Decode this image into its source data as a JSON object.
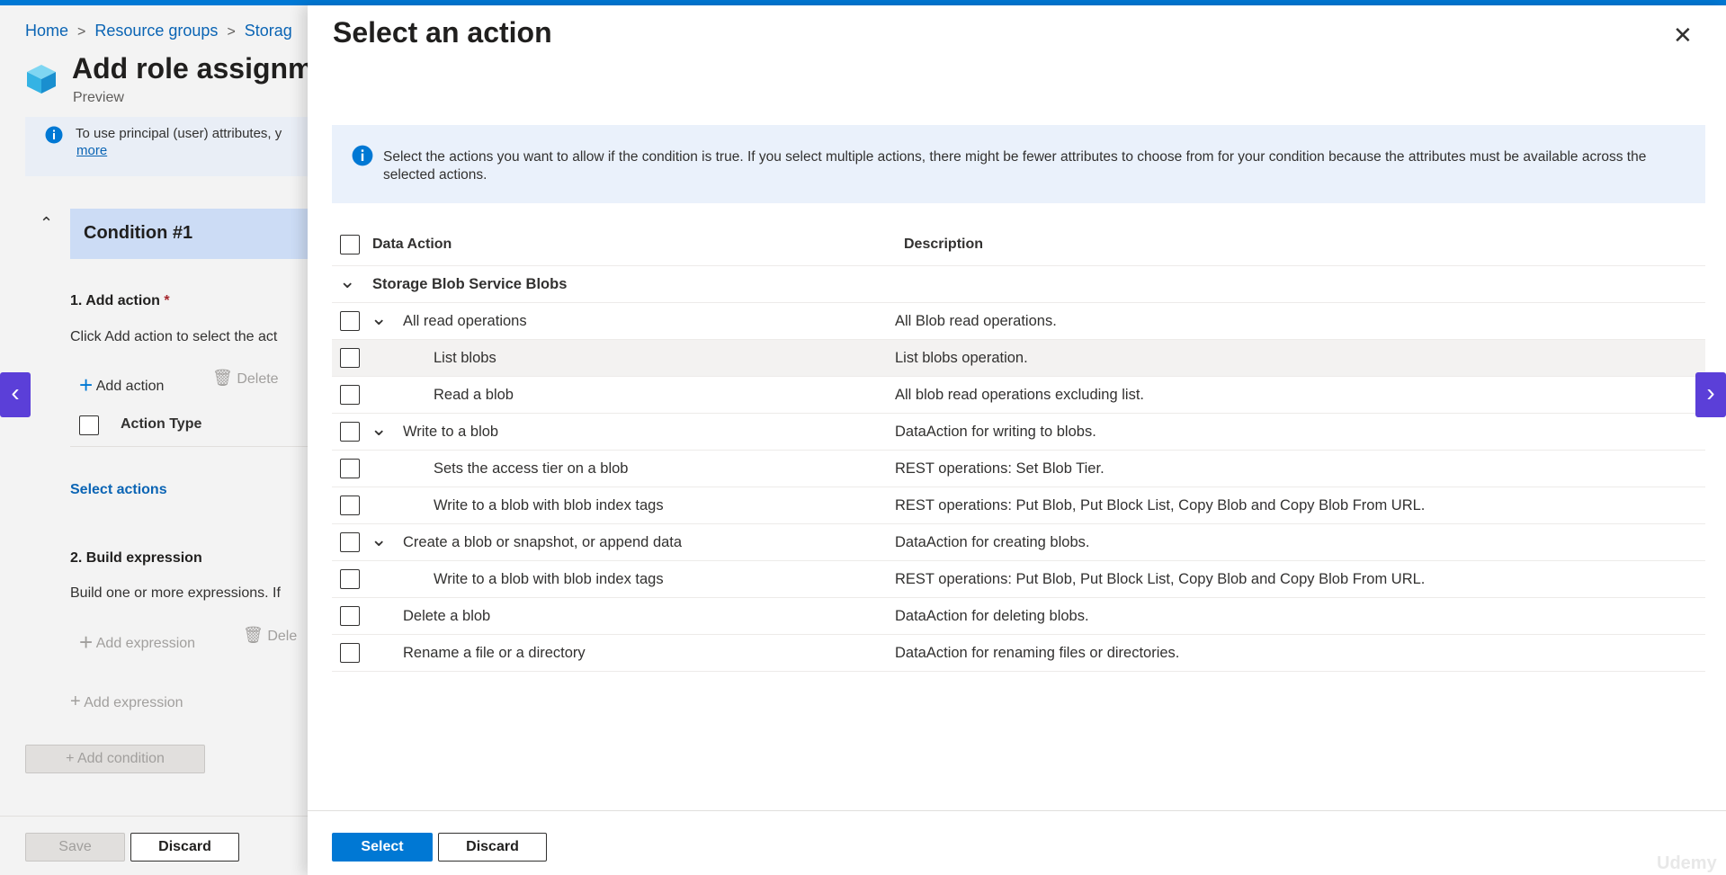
{
  "breadcrumb": [
    "Home",
    "Resource groups",
    "Storag"
  ],
  "page": {
    "title": "Add role assignm",
    "subtitle": "Preview",
    "info_text": "To use principal (user) attributes, y",
    "info_link": "more"
  },
  "condition": {
    "header": "Condition #1",
    "step1_label": "1. Add action",
    "step1_desc": "Click Add action to select the act",
    "add_action": "Add action",
    "delete": "Delete",
    "action_type_header": "Action Type",
    "select_actions": "Select actions",
    "step2_label": "2. Build expression",
    "step2_desc": "Build one or more expressions. If",
    "add_expression": "Add expression",
    "delete2": "Dele",
    "add_expression2": "Add expression",
    "add_condition": "Add condition"
  },
  "footer": {
    "save": "Save",
    "discard": "Discard"
  },
  "panel": {
    "title": "Select an action",
    "info": "Select the actions you want to allow if the condition is true. If you select multiple actions, there might be fewer attributes to choose from for your condition because the attributes must be available across the selected actions.",
    "col_action": "Data Action",
    "col_description": "Description",
    "group": "Storage Blob Service Blobs",
    "rows": [
      {
        "action": "All read operations",
        "description": "All Blob read operations."
      },
      {
        "action": "List blobs",
        "description": "List blobs operation."
      },
      {
        "action": "Read a blob",
        "description": "All blob read operations excluding list."
      },
      {
        "action": "Write to a blob",
        "description": "DataAction for writing to blobs."
      },
      {
        "action": "Sets the access tier on a blob",
        "description": "REST operations: Set Blob Tier."
      },
      {
        "action": "Write to a blob with blob index tags",
        "description": "REST operations: Put Blob, Put Block List, Copy Blob and Copy Blob From URL."
      },
      {
        "action": "Create a blob or snapshot, or append data",
        "description": "DataAction for creating blobs."
      },
      {
        "action": "Write to a blob with blob index tags",
        "description": "REST operations: Put Blob, Put Block List, Copy Blob and Copy Blob From URL."
      },
      {
        "action": "Delete a blob",
        "description": "DataAction for deleting blobs."
      },
      {
        "action": "Rename a file or a directory",
        "description": "DataAction for renaming files or directories."
      }
    ],
    "select_button": "Select",
    "discard_button": "Discard"
  },
  "watermark": "Udemy",
  "colors": {
    "accent": "#0078d4",
    "condition_header": "#ccdcf5",
    "nav_arrow": "#5b3fd8"
  }
}
